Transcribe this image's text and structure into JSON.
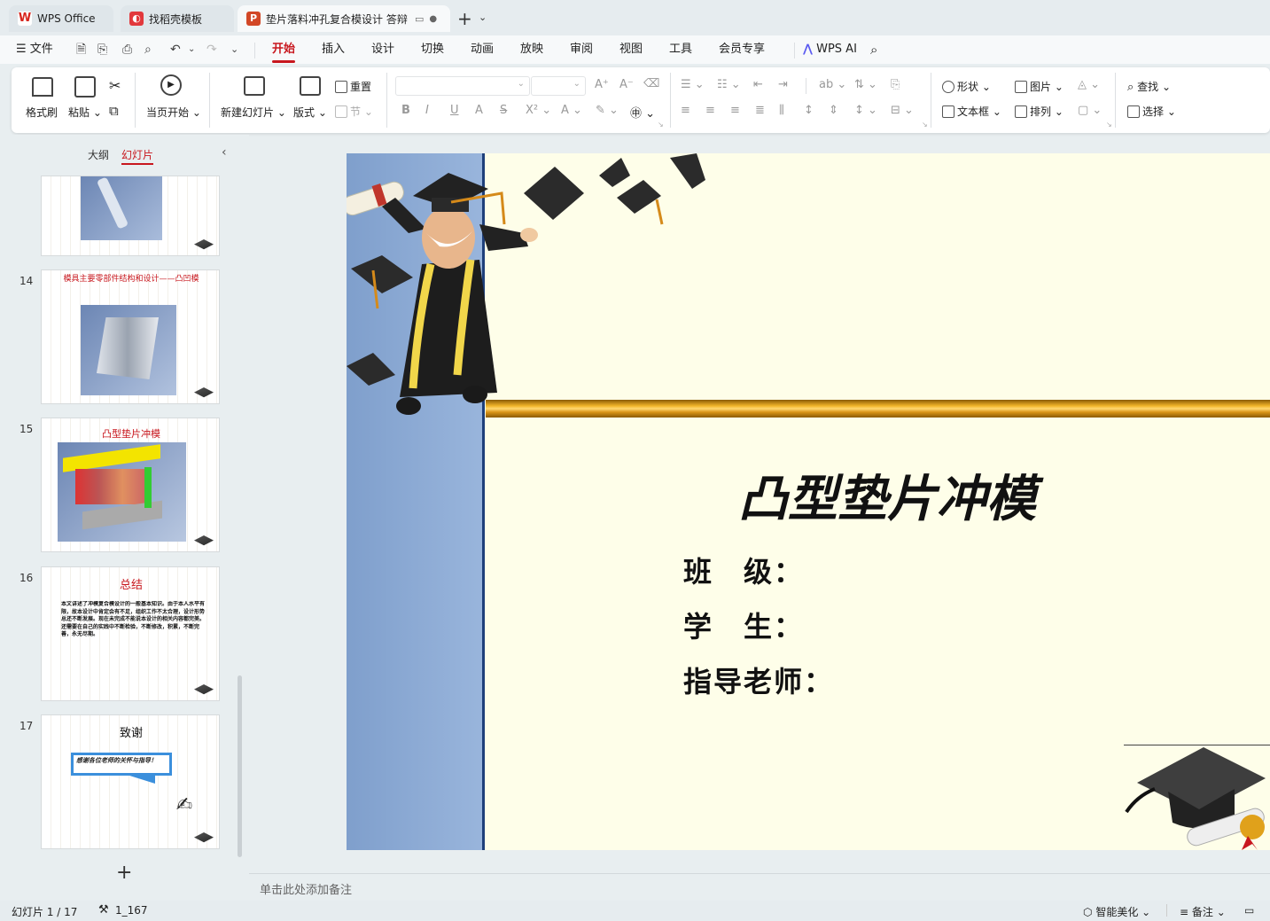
{
  "tabs": [
    {
      "label": "WPS Office",
      "icon": "wps-logo-icon",
      "color": "#d7261e"
    },
    {
      "label": "找稻壳模板",
      "icon": "docer-icon",
      "color": "#e2383c"
    },
    {
      "label": "垫片落料冲孔复合模设计 答辩",
      "icon": "presentation-icon",
      "color": "#d24726"
    }
  ],
  "menu": {
    "file": "文件",
    "items": [
      "开始",
      "插入",
      "设计",
      "切换",
      "动画",
      "放映",
      "审阅",
      "视图",
      "工具",
      "会员专享"
    ],
    "active": "开始",
    "wps_ai": "WPS AI"
  },
  "ribbon": {
    "format_painter": "格式刷",
    "paste": "粘贴",
    "from_current": "当页开始",
    "new_slide": "新建幻灯片",
    "layout": "版式",
    "reset": "重置",
    "section": "节",
    "shape": "形状",
    "picture": "图片",
    "textbox": "文本框",
    "arrange": "排列",
    "find": "查找",
    "select": "选择"
  },
  "panel": {
    "outline_tab": "大纲",
    "slides_tab": "幻灯片",
    "add": "+"
  },
  "thumbs": [
    {
      "num": "14",
      "title": "模具主要零部件结构和设计——凸凹模"
    },
    {
      "num": "15",
      "title": "凸型垫片冲模"
    },
    {
      "num": "16",
      "title": "总结",
      "body": "本文讲述了冲模复合模设计的一般基本知识。由于本人水平有限，故本设计中肯定会有不足，组织工作不太合理，设计形势总还不断发展。现在未完成不能说本设计的相关内容都完美。还需要在自己的实践中不断检验，不断修改，积累，不断完善，永无尽期。"
    },
    {
      "num": "17",
      "title": "致谢",
      "bubble": "感谢各位老师的关怀与指导！"
    }
  ],
  "slide": {
    "title": "凸型垫片冲模",
    "class_label": "班　级：",
    "student_label": "学　生：",
    "advisor_label": "指导老师："
  },
  "notes_placeholder": "单击此处添加备注",
  "status": {
    "slide_counter": "幻灯片 1 / 17",
    "theme": "1_167",
    "beautify": "智能美化",
    "notes": "备注"
  },
  "colors": {
    "accent": "#c8171e",
    "slide_bg": "#fefee9",
    "side_band": "#8fafd6",
    "gold_bar": "#d4900f"
  }
}
